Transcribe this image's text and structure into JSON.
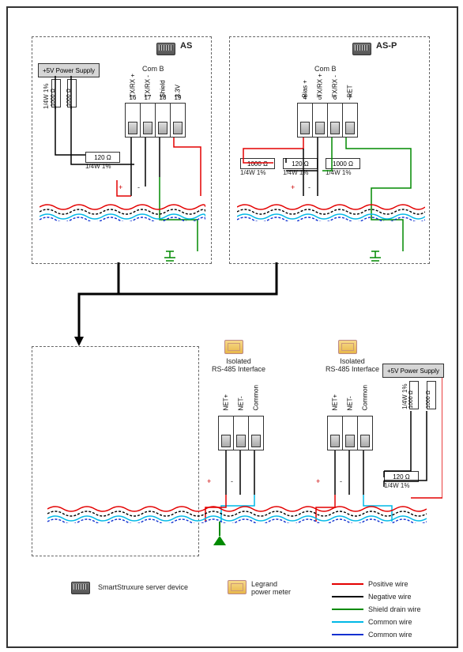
{
  "as_block": {
    "title": "AS",
    "psu_label": "+5V Power Supply",
    "comport": "Com B",
    "resistors_v": [
      "1000 Ω",
      "1000 Ω"
    ],
    "resistors_v_sub": "1/4W 1%",
    "terminator": "120 Ω",
    "terminator_sub": "1/4W 1%",
    "pins": [
      {
        "num": "16",
        "label": "TX/RX +"
      },
      {
        "num": "17",
        "label": "TX/RX -"
      },
      {
        "num": "18",
        "label": "Shield"
      },
      {
        "num": "19",
        "label": "3.3V"
      }
    ]
  },
  "asp_block": {
    "title": "AS-P",
    "comport": "Com B",
    "resistors": [
      "1000 Ω",
      "120 Ω",
      "1000 Ω"
    ],
    "resistors_sub": "1/4W 1%",
    "pins": [
      {
        "num": "4",
        "label": "Bias +"
      },
      {
        "num": "5",
        "label": "TX/RX +"
      },
      {
        "num": "6",
        "label": "TX/RX -"
      },
      {
        "num": "7",
        "label": "RET"
      }
    ]
  },
  "meter_block": {
    "interface_label": "Isolated\nRS-485 Interface",
    "psu_label": "+5V Power Supply",
    "resistors_v": [
      "1000 Ω",
      "1000 Ω"
    ],
    "resistors_v_sub": "1/4W 1%",
    "terminator": "120 Ω",
    "terminator_sub": "1/4W 1%",
    "pins": [
      {
        "label": "NET+"
      },
      {
        "label": "NET-"
      },
      {
        "label": "Common"
      }
    ]
  },
  "legend": {
    "device": "SmartStruxure server device",
    "meter": "Legrand\npower meter",
    "wires": [
      {
        "color": "#e30000",
        "label": "Positive wire"
      },
      {
        "color": "#000000",
        "label": "Negative wire"
      },
      {
        "color": "#008a00",
        "label": "Shield drain wire"
      },
      {
        "color": "#00b8e6",
        "label": "Common wire"
      },
      {
        "color": "#1030d0",
        "label": "Common wire"
      }
    ]
  },
  "polarity": {
    "plus": "+",
    "minus": "-"
  }
}
